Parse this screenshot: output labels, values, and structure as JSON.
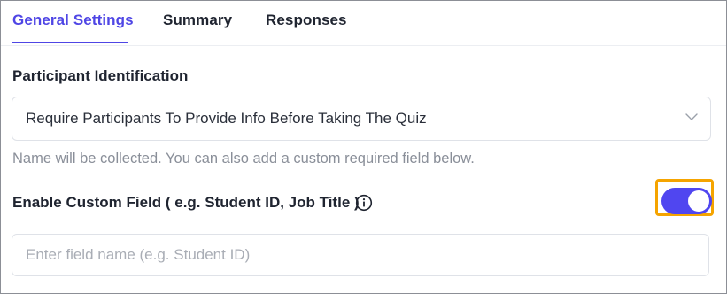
{
  "tabs": [
    {
      "label": "General Settings",
      "active": true
    },
    {
      "label": "Summary",
      "active": false
    },
    {
      "label": "Responses",
      "active": false
    }
  ],
  "participant_identification": {
    "title": "Participant Identification",
    "selected_option": "Require Participants To Provide Info Before Taking The Quiz",
    "helper_text": "Name will be collected. You can also add a custom required field below."
  },
  "custom_field": {
    "label": "Enable Custom Field ( e.g. Student ID, Job Title )",
    "info_icon": "info-circle-icon",
    "toggle_on": true,
    "input_value": "",
    "input_placeholder": "Enter field name (e.g. Student ID)"
  },
  "colors": {
    "accent": "#4f46e5",
    "toggle_on": "#5046f0",
    "highlight": "#f5a400",
    "muted_text": "#8a8f99"
  }
}
